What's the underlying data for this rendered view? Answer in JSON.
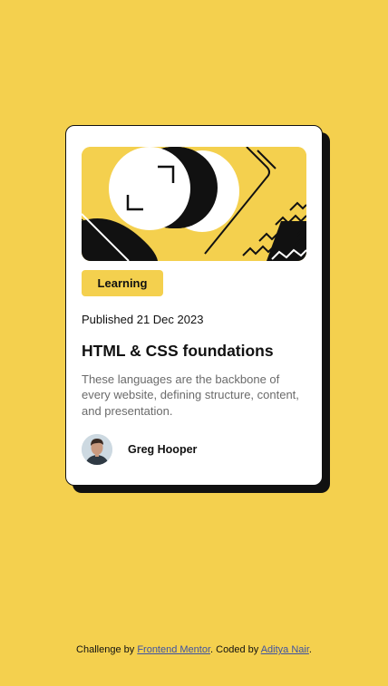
{
  "card": {
    "illustration": "abstract-illustration",
    "category": "Learning",
    "published": "Published 21 Dec 2023",
    "title": "HTML & CSS foundations",
    "description": "These languages are the backbone of every website, defining structure, content, and presentation.",
    "author": {
      "name": "Greg Hooper",
      "avatar": "avatar-image"
    }
  },
  "attribution": {
    "prefix": "Challenge by ",
    "challenge_link": "Frontend Mentor",
    "middle": ". Coded by ",
    "author_link": "Aditya Nair",
    "suffix": "."
  },
  "colors": {
    "background": "#f4d04e",
    "card": "#ffffff",
    "shadow": "#111111",
    "text": "#111111",
    "muted": "#6b6b6b",
    "link": "#3e52a3"
  }
}
